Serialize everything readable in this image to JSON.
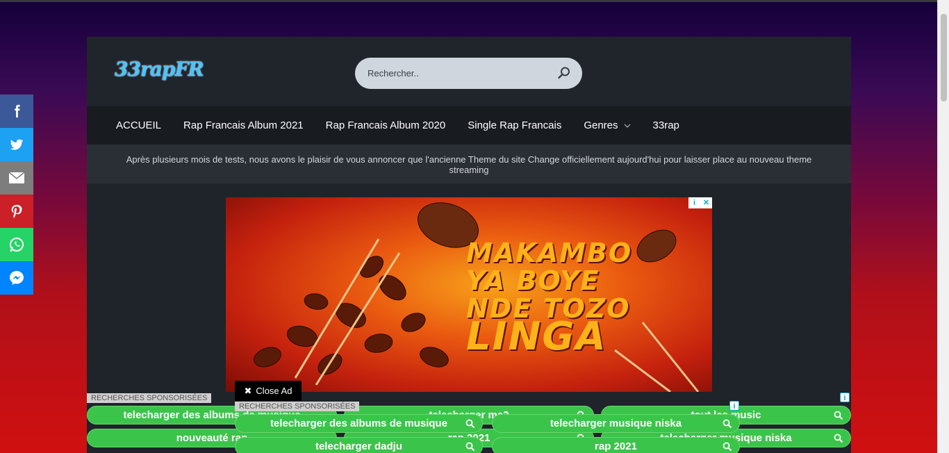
{
  "site": {
    "logo": "33rapFR",
    "search": {
      "placeholder": "Rechercher.."
    },
    "nav": [
      {
        "label": "ACCUEIL"
      },
      {
        "label": "Rap Francais Album 2021"
      },
      {
        "label": "Rap Francais Album 2020"
      },
      {
        "label": "Single Rap Francais"
      },
      {
        "label": "Genres"
      },
      {
        "label": "33rap"
      }
    ],
    "notice": "Après plusieurs mois de tests, nous avons le plaisir de vous annoncer que l'ancienne Theme du site Change officiellement aujourd'hui pour laisser place au nouveau theme streaming"
  },
  "ad": {
    "lines": [
      "MAKAMBO",
      "YA BOYE",
      "NDE TOZO",
      "LINGA"
    ],
    "badge_info": "i",
    "badge_close": "✕",
    "colors": {
      "accent": "#ffb21a",
      "background": "#ea5a10"
    }
  },
  "close_ad": {
    "label": "Close Ad",
    "icon": "✖"
  },
  "sponsored_back": {
    "label": "RECHERCHES SPONSORISÉES",
    "info": "i",
    "pills": [
      {
        "label": "telecharger des albums de musique"
      },
      {
        "label": "telecharger ma2"
      },
      {
        "label": "tout les music"
      },
      {
        "label": "nouveauté rap"
      },
      {
        "label": "rap 2021"
      },
      {
        "label": "telecharger musique niska"
      }
    ]
  },
  "sponsored_front": {
    "label": "RECHERCHES SPONSORISÉES",
    "info": "i",
    "pills": [
      {
        "label": "telecharger des albums de musique"
      },
      {
        "label": "telecharger musique niska"
      },
      {
        "label": "telecharger dadju"
      },
      {
        "label": "rap 2021"
      }
    ]
  },
  "social": [
    {
      "name": "facebook",
      "color": "#3b5998"
    },
    {
      "name": "twitter",
      "color": "#1da1f2"
    },
    {
      "name": "email",
      "color": "#7d7d7d"
    },
    {
      "name": "pinterest",
      "color": "#cb2027"
    },
    {
      "name": "whatsapp",
      "color": "#25d366"
    },
    {
      "name": "messenger",
      "color": "#0084ff"
    }
  ]
}
